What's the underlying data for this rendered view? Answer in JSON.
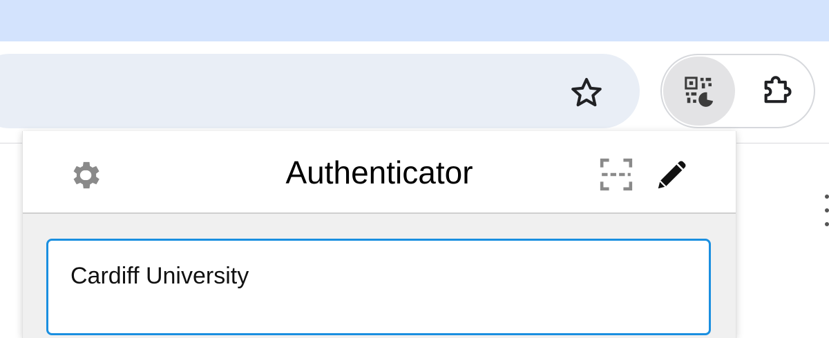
{
  "browser": {
    "bookmark_icon": "star-outline-icon",
    "active_extension_icon": "qr-code-icon",
    "extensions_menu_icon": "puzzle-piece-icon",
    "colors": {
      "tabstrip": "#d3e3fd",
      "omnibox": "#e9eef6",
      "active_extension_bg": "#e3e3e5"
    }
  },
  "popup": {
    "title": "Authenticator",
    "settings_icon": "gear-icon",
    "scan_icon": "scan-qr-icon",
    "edit_icon": "pencil-icon",
    "accounts": [
      {
        "issuer": "Cardiff University"
      }
    ],
    "colors": {
      "selected_border": "#1a8fe0",
      "body_bg": "#f0f0f0"
    }
  }
}
